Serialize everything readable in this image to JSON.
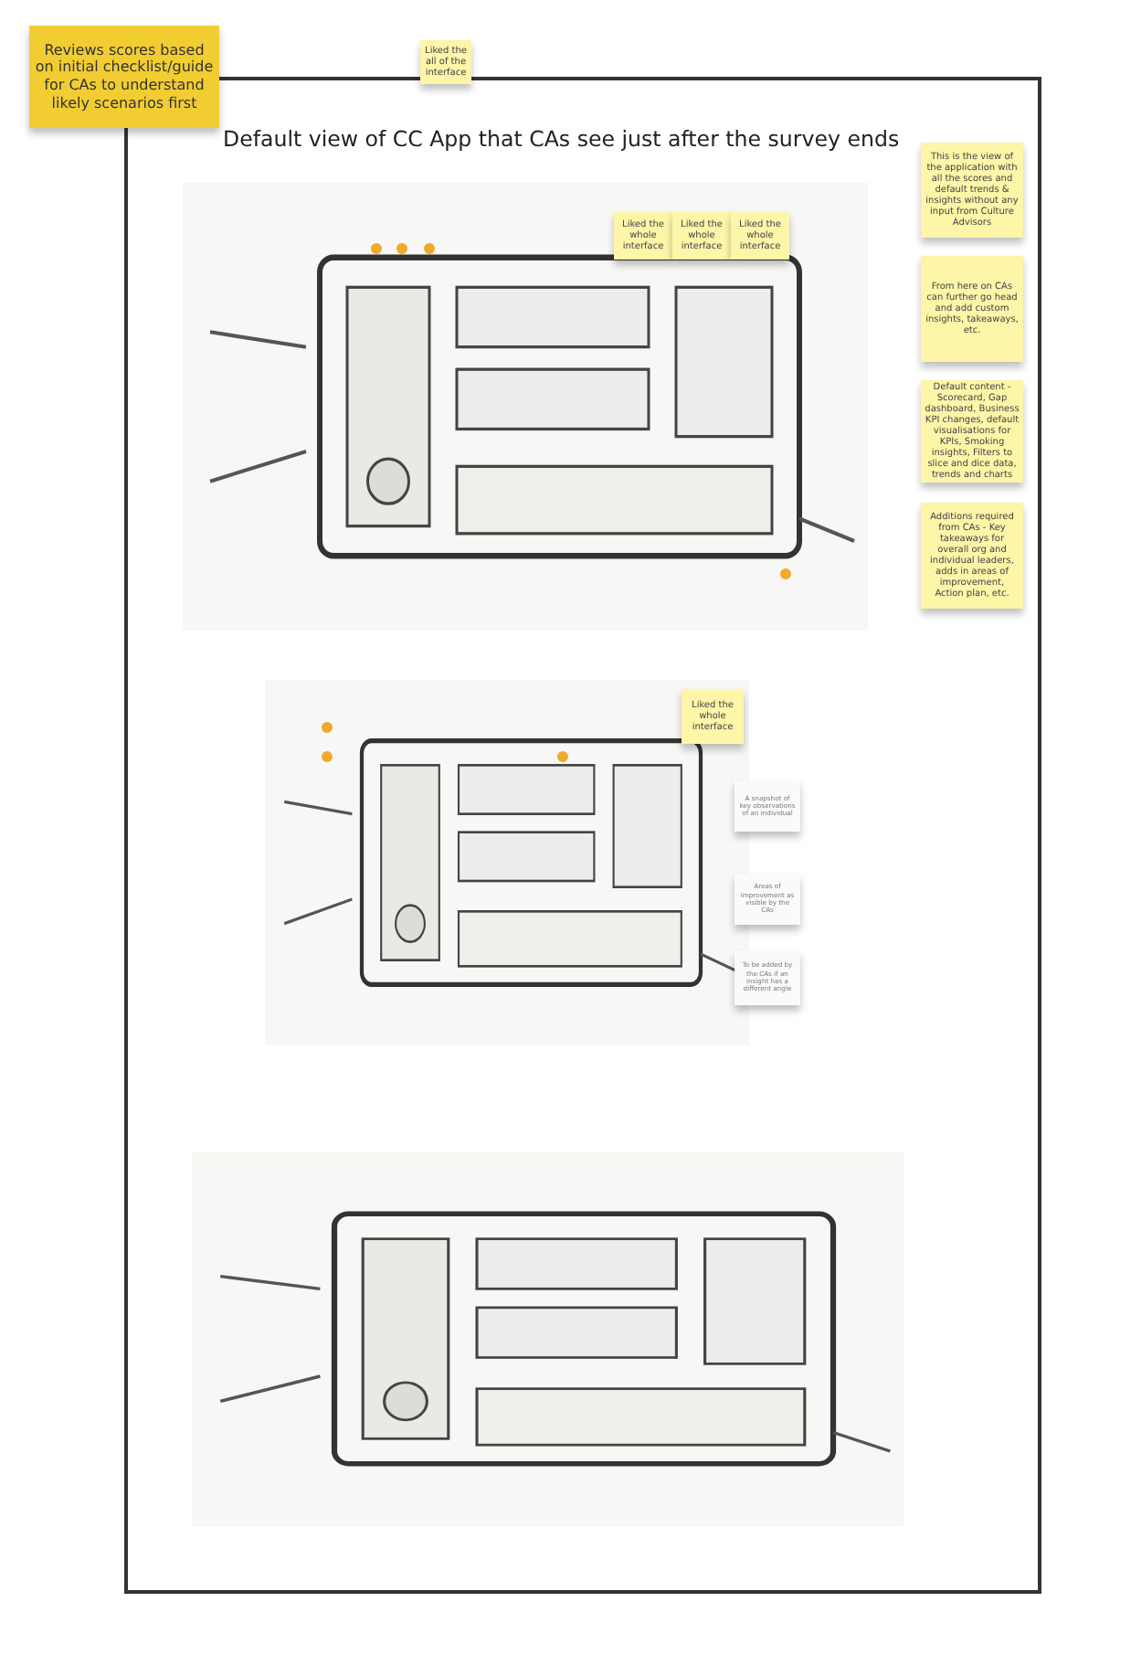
{
  "frame": {
    "title": "Default view of CC App that CAs see just after the survey ends"
  },
  "notes": [
    {
      "kind": "yellow",
      "text": "Reviews scores based on initial checklist/guide for CAs to understand likely scenarios first"
    },
    {
      "kind": "sticky",
      "text": "Liked the all of the interface"
    },
    {
      "kind": "sticky",
      "text": "Liked the whole interface"
    },
    {
      "kind": "sticky",
      "text": "Liked the whole interface"
    },
    {
      "kind": "sticky",
      "text": "Liked the whole interface"
    },
    {
      "kind": "sticky",
      "text": "This is the view of the application with all the scores and default trends & insights without any input from Culture Advisors"
    },
    {
      "kind": "sticky",
      "text": "From here on CAs can further go head and add custom insights, takeaways, etc."
    },
    {
      "kind": "sticky",
      "text": "Default content - Scorecard, Gap dashboard, Business KPI changes, default visualisations for KPIs, Smoking insights, Filters to slice and dice data, trends and charts"
    },
    {
      "kind": "sticky",
      "text": "Additions required from CAs - Key takeaways for overall org and individual leaders, adds in areas of improvement, Action plan, etc."
    },
    {
      "kind": "sticky",
      "text": "Liked the whole interface"
    },
    {
      "kind": "card",
      "text": "A snapshot of key observations of an individual"
    },
    {
      "kind": "card",
      "text": "Areas of improvement as visible by the CAs"
    },
    {
      "kind": "card",
      "text": "To be added by the CAs if an insight has a different angle"
    }
  ]
}
